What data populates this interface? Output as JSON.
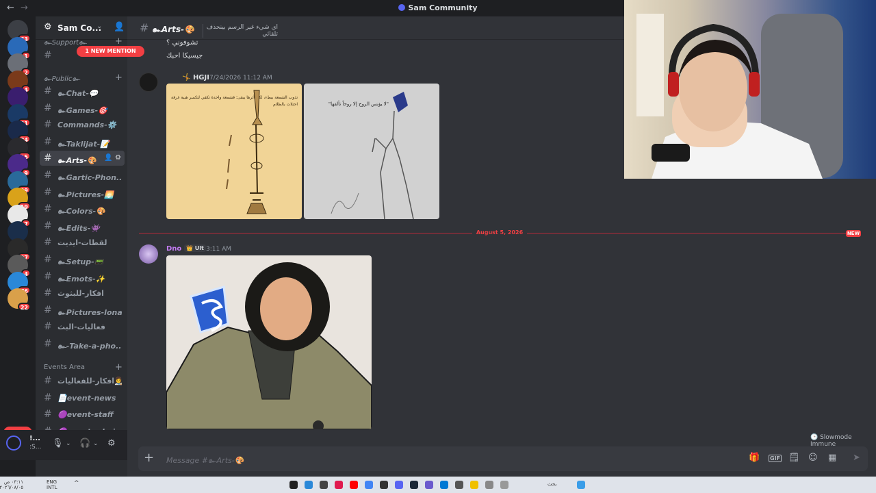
{
  "window": {
    "title": "Sam Community",
    "back": "←",
    "forward": "→"
  },
  "guilds": [
    {
      "badge": "63",
      "color": "#3c3f45"
    },
    {
      "badge": "1",
      "color": "#2a6ab8"
    },
    {
      "badge": "2",
      "color": "#6b6f77"
    },
    {
      "badge": "4",
      "color": "#7a3a1a"
    },
    {
      "badge": "",
      "color": "#3a1e6e"
    },
    {
      "badge": "31",
      "color": "#1a3a66"
    },
    {
      "badge": "34",
      "color": "#1a2a4a"
    },
    {
      "badge": "15",
      "color": "#2a2a2e"
    },
    {
      "badge": "9",
      "color": "#4b2a8a"
    },
    {
      "badge": "29",
      "color": "#2a6a9a"
    },
    {
      "badge": "19",
      "color": "#d9a21a"
    },
    {
      "badge": "7",
      "color": "#e8e8e8"
    },
    {
      "badge": "",
      "color": "#1a2e4a"
    },
    {
      "badge": "97",
      "color": "#2a2a2a"
    },
    {
      "badge": "4",
      "color": "#5a5a5a"
    },
    {
      "badge": "76",
      "color": "#2a88d8"
    },
    {
      "badge": "22",
      "color": "#d9a04a"
    }
  ],
  "guilds_new": "NEW",
  "server": {
    "name": "Sam Co...",
    "new_mention": "1 NEW MENTION"
  },
  "categories": {
    "support": "๛Support๛",
    "public": "๛Public๛",
    "events": "Events Area"
  },
  "channels": [
    {
      "name": "๛Chat-💬"
    },
    {
      "name": "๛Games-🎯"
    },
    {
      "name": "Commands-⚙️"
    },
    {
      "name": "๛Taklijat-📝"
    },
    {
      "name": "๛Arts-🎨",
      "active": true
    },
    {
      "name": "๛Gartic-Phon..."
    },
    {
      "name": "๛Pictures-🌅"
    },
    {
      "name": "๛Colors-🎨"
    },
    {
      "name": "๛Edits-👾"
    },
    {
      "name": "لقطات-ايديت"
    },
    {
      "name": "๛Setup-📟"
    },
    {
      "name": "๛Emots-✨"
    },
    {
      "name": "افكار-للبثوث"
    },
    {
      "name": "๛Pictures-lona"
    },
    {
      "name": "فعاليات-البث"
    },
    {
      "name": "๛-Take-a-pho..."
    }
  ],
  "event_channels": [
    {
      "name": "افكار-للفعاليات👩‍🎨"
    },
    {
      "name": "📄event-news"
    },
    {
      "name": "🟣event-staff"
    },
    {
      "name": "🟣event-admin"
    }
  ],
  "user": {
    "name": "!...",
    "status": ":S..."
  },
  "channel_header": {
    "name": "๛Arts-🎨",
    "topic": "اي شيء غير الرسم بينحذف تلقائي"
  },
  "messages": {
    "prev_lines": [
      "تشوفوني ؟",
      "جيسيكا احبك"
    ],
    "m1": {
      "author": "HGJI",
      "time": "7/24/2026 11:12 AM",
      "caption1": "تذوب الشمعة ببطء، لكن أثرها يبقى؛ فشمعة واحدة تكفي لتكسر هيبة غرفة احتلات بالظلام",
      "caption2": "\"لا يؤنس الروح إلا روحاً تألفها\""
    },
    "divider_date": "August 5, 2026",
    "divider_new": "NEW",
    "m2": {
      "author": "Dno",
      "tag": "Ult",
      "time": "3:11 AM"
    }
  },
  "slowmode": "Slowmode Immune",
  "composer": {
    "placeholder": "Message #๛Arts-🎨"
  },
  "taskbar": {
    "lang": "ENG INTL",
    "search": "بحث",
    "clock": "٠٣:١١ ص ٢٠٢٦/٠٨/٠٥"
  }
}
